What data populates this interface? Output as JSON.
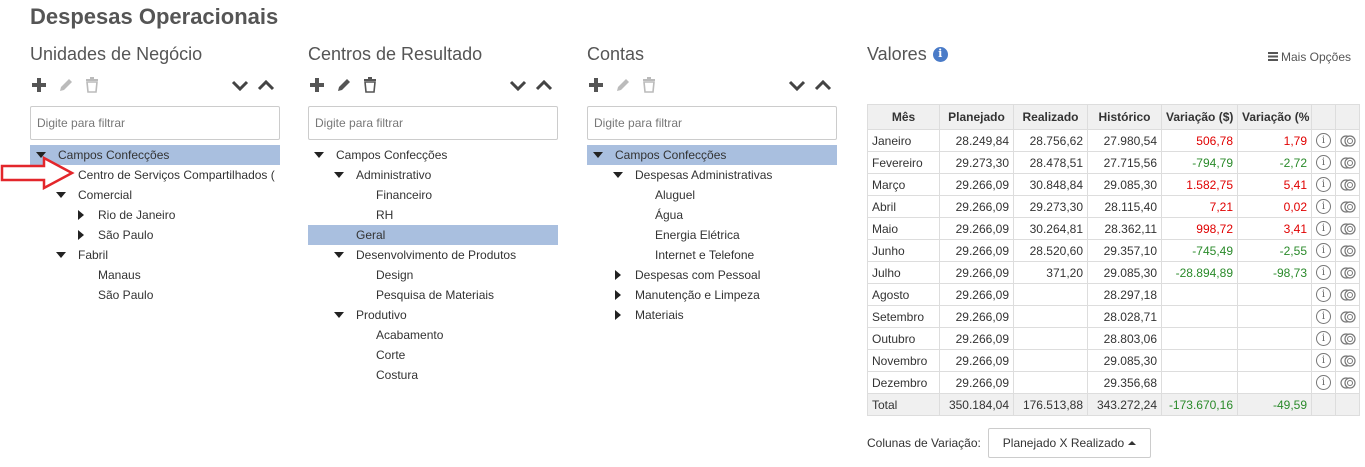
{
  "page": {
    "title": "Despesas Operacionais"
  },
  "unidades": {
    "title": "Unidades de Negócio",
    "filter_placeholder": "Digite para filtrar",
    "items": [
      {
        "label": "Campos Confecções",
        "level": 0,
        "caret": "down",
        "selected": true
      },
      {
        "label": "Centro de Serviços Compartilhados (",
        "level": 1,
        "caret": "none",
        "selected": false
      },
      {
        "label": "Comercial",
        "level": 1,
        "caret": "down",
        "selected": false
      },
      {
        "label": "Rio de Janeiro",
        "level": 2,
        "caret": "right",
        "selected": false
      },
      {
        "label": "São Paulo",
        "level": 2,
        "caret": "right",
        "selected": false
      },
      {
        "label": "Fabril",
        "level": 1,
        "caret": "down",
        "selected": false
      },
      {
        "label": "Manaus",
        "level": 2,
        "caret": "none",
        "selected": false
      },
      {
        "label": "São Paulo",
        "level": 2,
        "caret": "none",
        "selected": false
      }
    ]
  },
  "centros": {
    "title": "Centros de Resultado",
    "filter_placeholder": "Digite para filtrar",
    "items": [
      {
        "label": "Campos Confecções",
        "level": 0,
        "caret": "down",
        "selected": false
      },
      {
        "label": "Administrativo",
        "level": 1,
        "caret": "down",
        "selected": false
      },
      {
        "label": "Financeiro",
        "level": 2,
        "caret": "none",
        "selected": false
      },
      {
        "label": "RH",
        "level": 2,
        "caret": "none",
        "selected": false
      },
      {
        "label": "Geral",
        "level": 1,
        "caret": "none",
        "selected": true
      },
      {
        "label": "Desenvolvimento de Produtos",
        "level": 1,
        "caret": "down",
        "selected": false
      },
      {
        "label": "Design",
        "level": 2,
        "caret": "none",
        "selected": false
      },
      {
        "label": "Pesquisa de Materiais",
        "level": 2,
        "caret": "none",
        "selected": false
      },
      {
        "label": "Produtivo",
        "level": 1,
        "caret": "down",
        "selected": false
      },
      {
        "label": "Acabamento",
        "level": 2,
        "caret": "none",
        "selected": false
      },
      {
        "label": "Corte",
        "level": 2,
        "caret": "none",
        "selected": false
      },
      {
        "label": "Costura",
        "level": 2,
        "caret": "none",
        "selected": false
      }
    ]
  },
  "contas": {
    "title": "Contas",
    "filter_placeholder": "Digite para filtrar",
    "items": [
      {
        "label": "Campos Confecções",
        "level": 0,
        "caret": "down",
        "selected": true
      },
      {
        "label": "Despesas Administrativas",
        "level": 1,
        "caret": "down",
        "selected": false
      },
      {
        "label": "Aluguel",
        "level": 2,
        "caret": "none",
        "selected": false
      },
      {
        "label": "Água",
        "level": 2,
        "caret": "none",
        "selected": false
      },
      {
        "label": "Energia Elétrica",
        "level": 2,
        "caret": "none",
        "selected": false
      },
      {
        "label": "Internet e Telefone",
        "level": 2,
        "caret": "none",
        "selected": false
      },
      {
        "label": "Despesas com Pessoal",
        "level": 1,
        "caret": "right",
        "selected": false
      },
      {
        "label": "Manutenção e Limpeza",
        "level": 1,
        "caret": "right",
        "selected": false
      },
      {
        "label": "Materiais",
        "level": 1,
        "caret": "right",
        "selected": false
      }
    ]
  },
  "valores": {
    "title": "Valores",
    "info_icon": "info-icon",
    "mais_opcoes": "Mais Opções",
    "columns": [
      "Mês",
      "Planejado",
      "Realizado",
      "Histórico",
      "Variação ($)",
      "Variação (%"
    ],
    "rows": [
      {
        "mes": "Janeiro",
        "planejado": "28.249,84",
        "realizado": "28.756,62",
        "historico": "27.980,54",
        "var_abs": "506,78",
        "var_pct": "1,79",
        "sign": "pos"
      },
      {
        "mes": "Fevereiro",
        "planejado": "29.273,30",
        "realizado": "28.478,51",
        "historico": "27.715,56",
        "var_abs": "-794,79",
        "var_pct": "-2,72",
        "sign": "neg"
      },
      {
        "mes": "Março",
        "planejado": "29.266,09",
        "realizado": "30.848,84",
        "historico": "29.085,30",
        "var_abs": "1.582,75",
        "var_pct": "5,41",
        "sign": "pos"
      },
      {
        "mes": "Abril",
        "planejado": "29.266,09",
        "realizado": "29.273,30",
        "historico": "28.115,40",
        "var_abs": "7,21",
        "var_pct": "0,02",
        "sign": "pos"
      },
      {
        "mes": "Maio",
        "planejado": "29.266,09",
        "realizado": "30.264,81",
        "historico": "28.362,11",
        "var_abs": "998,72",
        "var_pct": "3,41",
        "sign": "pos"
      },
      {
        "mes": "Junho",
        "planejado": "29.266,09",
        "realizado": "28.520,60",
        "historico": "29.357,10",
        "var_abs": "-745,49",
        "var_pct": "-2,55",
        "sign": "neg"
      },
      {
        "mes": "Julho",
        "planejado": "29.266,09",
        "realizado": "371,20",
        "historico": "29.085,30",
        "var_abs": "-28.894,89",
        "var_pct": "-98,73",
        "sign": "neg"
      },
      {
        "mes": "Agosto",
        "planejado": "29.266,09",
        "realizado": "",
        "historico": "28.297,18",
        "var_abs": "",
        "var_pct": "",
        "sign": "none"
      },
      {
        "mes": "Setembro",
        "planejado": "29.266,09",
        "realizado": "",
        "historico": "28.028,71",
        "var_abs": "",
        "var_pct": "",
        "sign": "none"
      },
      {
        "mes": "Outubro",
        "planejado": "29.266,09",
        "realizado": "",
        "historico": "28.803,06",
        "var_abs": "",
        "var_pct": "",
        "sign": "none"
      },
      {
        "mes": "Novembro",
        "planejado": "29.266,09",
        "realizado": "",
        "historico": "29.085,30",
        "var_abs": "",
        "var_pct": "",
        "sign": "none"
      },
      {
        "mes": "Dezembro",
        "planejado": "29.266,09",
        "realizado": "",
        "historico": "29.356,68",
        "var_abs": "",
        "var_pct": "",
        "sign": "none"
      }
    ],
    "total": {
      "mes": "Total",
      "planejado": "350.184,04",
      "realizado": "176.513,88",
      "historico": "343.272,24",
      "var_abs": "-173.670,16",
      "var_pct": "-49,59"
    },
    "row_icons": [
      "info-circle-icon",
      "coins-icon"
    ]
  },
  "variacao": {
    "label": "Colunas de Variação:",
    "button": "Planejado X Realizado"
  },
  "colors": {
    "selected": "#a9bfdf",
    "negative": "#2a8a2a",
    "positive": "#e00000",
    "annotation_arrow": "#e3262b"
  }
}
